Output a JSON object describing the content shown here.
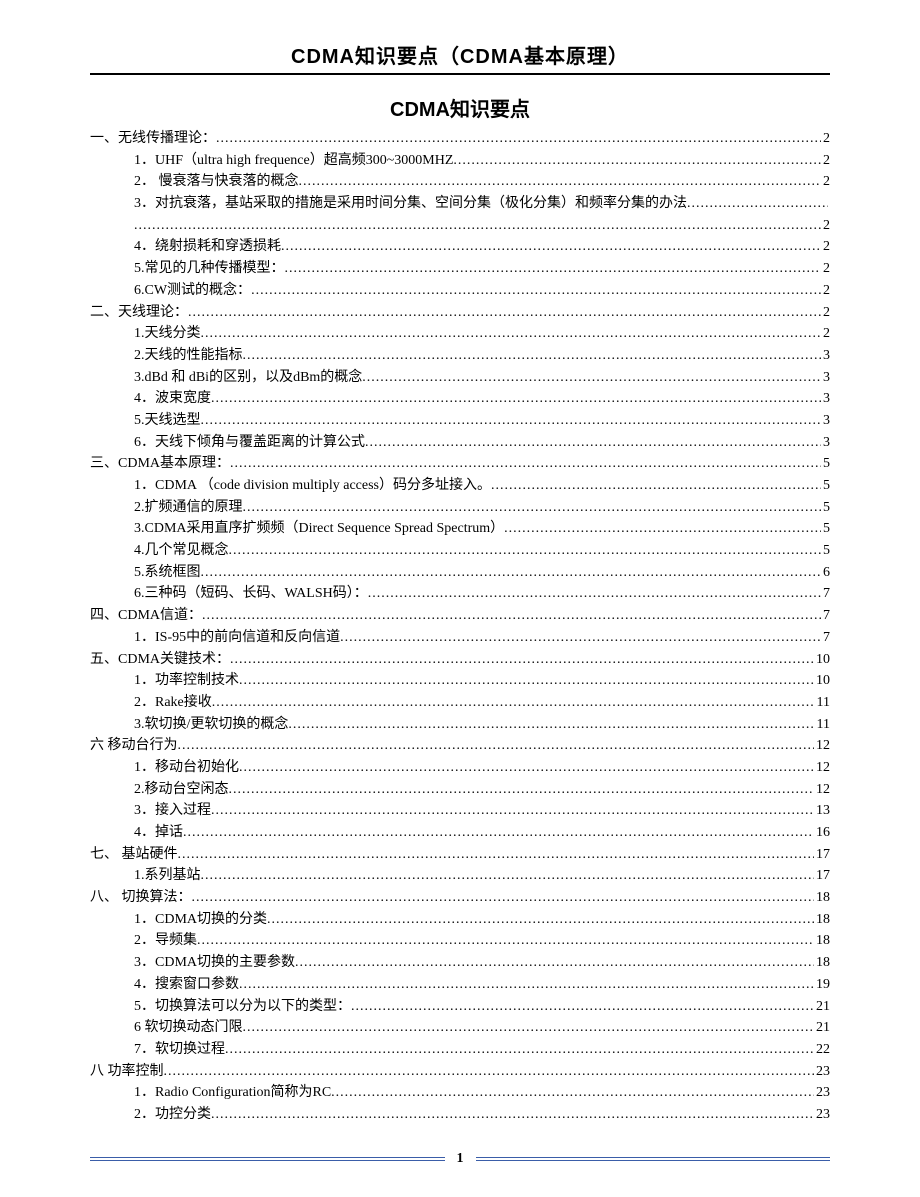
{
  "header": "CDMA知识要点（CDMA基本原理）",
  "title": "CDMA知识要点",
  "page_number": "1",
  "toc": [
    {
      "level": 1,
      "label": "一、无线传播理论：",
      "page": "2"
    },
    {
      "level": 2,
      "label": "1．UHF（ultra high frequence）超高频300~3000MHZ",
      "page": "2"
    },
    {
      "level": 2,
      "label": "2． 慢衰落与快衰落的概念",
      "page": "2"
    },
    {
      "level": 2,
      "label": "3．对抗衰落，基站采取的措施是采用时间分集、空间分集（极化分集）和频率分集的办法",
      "page": ""
    },
    {
      "level": 2,
      "label": "",
      "page": "2"
    },
    {
      "level": 2,
      "label": "4．绕射损耗和穿透损耗",
      "page": "2"
    },
    {
      "level": 2,
      "label": "5.常见的几种传播模型：",
      "page": "2"
    },
    {
      "level": 2,
      "label": "6.CW测试的概念：",
      "page": "2"
    },
    {
      "level": 1,
      "label": "二、天线理论：",
      "page": "2"
    },
    {
      "level": 2,
      "label": "1.天线分类",
      "page": "2"
    },
    {
      "level": 2,
      "label": "2.天线的性能指标",
      "page": "3"
    },
    {
      "level": 2,
      "label": "3.dBd 和 dBi的区别，以及dBm的概念",
      "page": "3"
    },
    {
      "level": 2,
      "label": "4．波束宽度",
      "page": "3"
    },
    {
      "level": 2,
      "label": "5.天线选型",
      "page": "3"
    },
    {
      "level": 2,
      "label": "6．天线下倾角与覆盖距离的计算公式",
      "page": "3"
    },
    {
      "level": 1,
      "label": "三、CDMA基本原理：",
      "page": "5"
    },
    {
      "level": 2,
      "label": "1．CDMA （code division multiply access）码分多址接入。",
      "page": "5"
    },
    {
      "level": 2,
      "label": "2.扩频通信的原理",
      "page": "5"
    },
    {
      "level": 2,
      "label": "3.CDMA采用直序扩频频（Direct Sequence Spread Spectrum）",
      "page": "5"
    },
    {
      "level": 2,
      "label": "4.几个常见概念",
      "page": "5"
    },
    {
      "level": 2,
      "label": "5.系统框图",
      "page": "6"
    },
    {
      "level": 2,
      "label": "6.三种码（短码、长码、WALSH码）：",
      "page": "7"
    },
    {
      "level": 1,
      "label": "四、CDMA信道：",
      "page": "7"
    },
    {
      "level": 2,
      "label": "1．IS-95中的前向信道和反向信道",
      "page": "7"
    },
    {
      "level": 1,
      "label": "五、CDMA关键技术：",
      "page": "10"
    },
    {
      "level": 2,
      "label": "1．功率控制技术",
      "page": "10"
    },
    {
      "level": 2,
      "label": "2．Rake接收",
      "page": "11"
    },
    {
      "level": 2,
      "label": "3.软切换/更软切换的概念",
      "page": "11"
    },
    {
      "level": 1,
      "label": "六 移动台行为",
      "page": "12"
    },
    {
      "level": 2,
      "label": "1．移动台初始化",
      "page": "12"
    },
    {
      "level": 2,
      "label": "2.移动台空闲态",
      "page": "12"
    },
    {
      "level": 2,
      "label": "3．接入过程",
      "page": "13"
    },
    {
      "level": 2,
      "label": "4．掉话",
      "page": "16"
    },
    {
      "level": 1,
      "label": "七、 基站硬件",
      "page": "17"
    },
    {
      "level": 2,
      "label": "1.系列基站",
      "page": "17"
    },
    {
      "level": 1,
      "label": "八、 切换算法：",
      "page": "18"
    },
    {
      "level": 2,
      "label": "1．CDMA切换的分类",
      "page": "18"
    },
    {
      "level": 2,
      "label": "2．导频集",
      "page": "18"
    },
    {
      "level": 2,
      "label": "3．CDMA切换的主要参数",
      "page": "18"
    },
    {
      "level": 2,
      "label": "4．搜索窗口参数",
      "page": "19"
    },
    {
      "level": 2,
      "label": "5．切换算法可以分为以下的类型：",
      "page": "21"
    },
    {
      "level": 2,
      "label": "6  软切换动态门限",
      "page": "21"
    },
    {
      "level": 2,
      "label": "7．软切换过程",
      "page": "22"
    },
    {
      "level": 1,
      "label": "八 功率控制",
      "page": "23"
    },
    {
      "level": 2,
      "label": "1．Radio Configuration简称为RC",
      "page": "23"
    },
    {
      "level": 2,
      "label": "2．功控分类",
      "page": "23"
    }
  ]
}
